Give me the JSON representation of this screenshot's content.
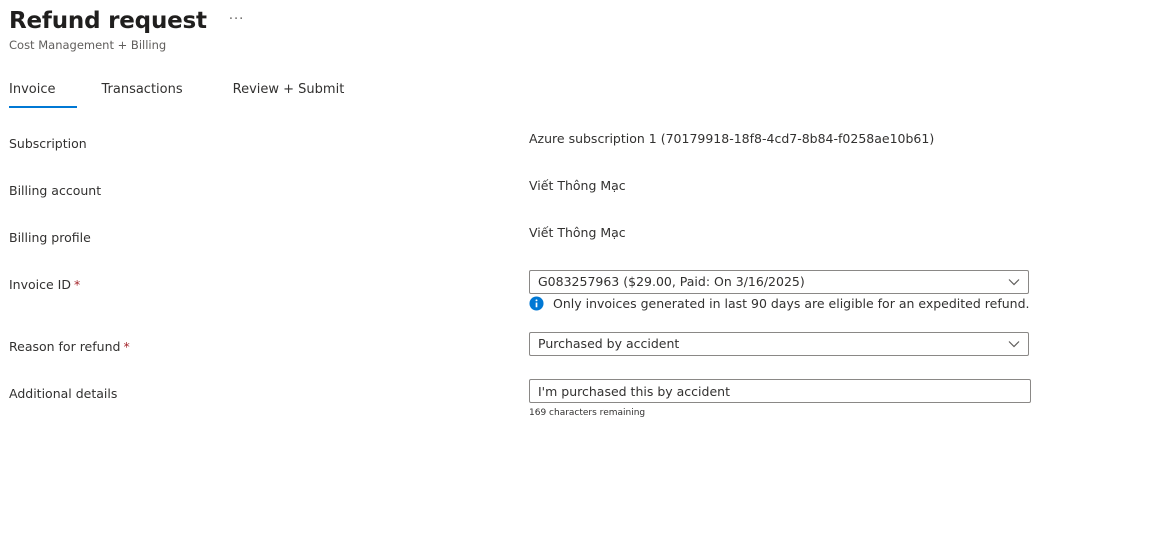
{
  "header": {
    "title": "Refund request",
    "more_label": "···",
    "subtitle": "Cost Management + Billing"
  },
  "tabs": [
    {
      "label": "Invoice",
      "active": true
    },
    {
      "label": "Transactions",
      "active": false
    },
    {
      "label": "Review + Submit",
      "active": false
    }
  ],
  "form": {
    "subscription": {
      "label": "Subscription",
      "value": "Azure subscription 1 (70179918-18f8-4cd7-8b84-f0258ae10b61)"
    },
    "billing_account": {
      "label": "Billing account",
      "value": "Viết Thông Mạc"
    },
    "billing_profile": {
      "label": "Billing profile",
      "value": "Viết Thông Mạc"
    },
    "invoice_id": {
      "label": "Invoice ID",
      "required_mark": "*",
      "selected": "G083257963 ($29.00, Paid: On 3/16/2025)",
      "info": "Only invoices generated in last 90 days are eligible for an expedited refund."
    },
    "reason": {
      "label": "Reason for refund",
      "required_mark": "*",
      "selected": "Purchased by accident"
    },
    "additional_details": {
      "label": "Additional details",
      "value": "I'm purchased this by accident",
      "remaining": "169 characters remaining"
    }
  },
  "colors": {
    "accent": "#0078d4",
    "required": "#a4262c",
    "info_icon": "#0078d4"
  }
}
